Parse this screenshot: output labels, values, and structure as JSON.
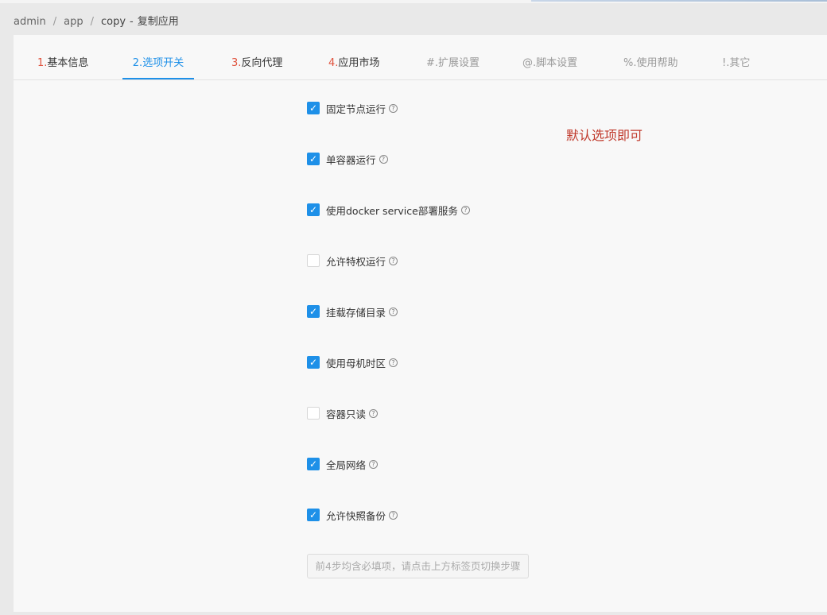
{
  "breadcrumb": {
    "items": [
      "admin",
      "app",
      "copy"
    ],
    "separator": "/",
    "dash": "-",
    "title": "复制应用"
  },
  "tabs": [
    {
      "num": "1.",
      "label": "基本信息",
      "state": "normal"
    },
    {
      "num": "2.",
      "label": "选项开关",
      "state": "active"
    },
    {
      "num": "3.",
      "label": "反向代理",
      "state": "normal"
    },
    {
      "num": "4.",
      "label": "应用市场",
      "state": "normal"
    },
    {
      "num": "#.",
      "label": "扩展设置",
      "state": "muted"
    },
    {
      "num": "@.",
      "label": "脚本设置",
      "state": "muted"
    },
    {
      "num": "%.",
      "label": "使用帮助",
      "state": "muted"
    },
    {
      "num": "!.",
      "label": "其它",
      "state": "muted"
    }
  ],
  "options": [
    {
      "label": "固定节点运行",
      "checked": true
    },
    {
      "label": "单容器运行",
      "checked": true
    },
    {
      "label": "使用docker service部署服务",
      "checked": true
    },
    {
      "label": "允许特权运行",
      "checked": false
    },
    {
      "label": "挂载存储目录",
      "checked": true
    },
    {
      "label": "使用母机时区",
      "checked": true
    },
    {
      "label": "容器只读",
      "checked": false
    },
    {
      "label": "全局网络",
      "checked": true
    },
    {
      "label": "允许快照备份",
      "checked": true
    }
  ],
  "note": "默认选项即可",
  "submit_label": "前4步均含必填项，请点击上方标签页切换步骤",
  "colors": {
    "accent": "#1e90e8",
    "tab_number": "#e0533e",
    "note": "#c0392b"
  }
}
